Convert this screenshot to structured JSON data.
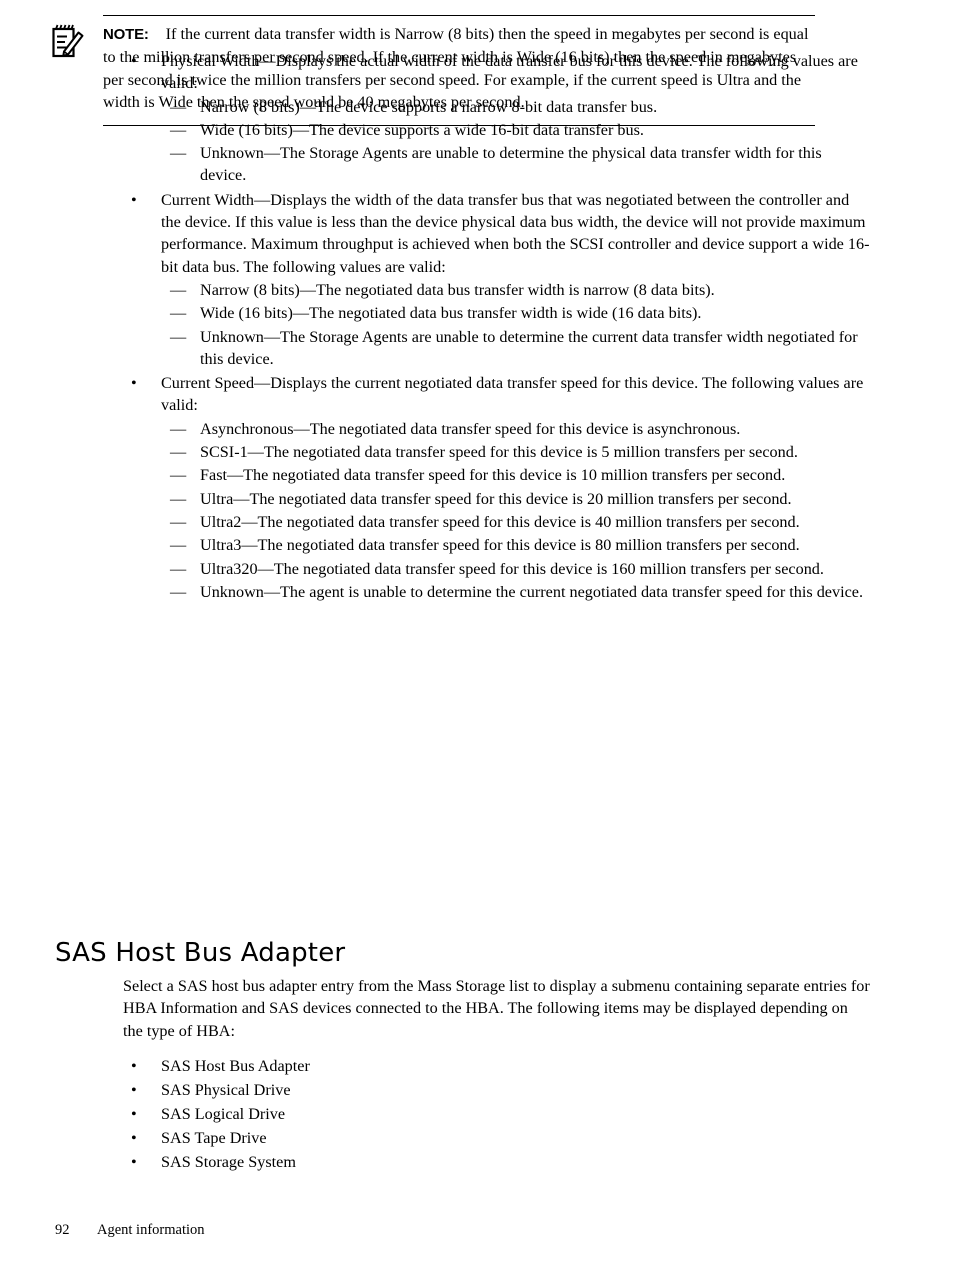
{
  "page": {
    "footer_page_number": "92",
    "footer_chapter": "Agent information"
  },
  "bullets": [
    {
      "lead": "Physical Width—Displays the actual width of the data transfer bus for this device. The following values are valid:",
      "sub": [
        "Narrow (8 bits)—The device supports a narrow 8-bit data transfer bus.",
        "Wide (16 bits)—The device supports a wide 16-bit data transfer bus.",
        "Unknown—The Storage Agents are unable to determine the physical data transfer width for this device."
      ]
    },
    {
      "lead": "Current Width—Displays the width of the data transfer bus that was negotiated between the controller and the device. If this value is less than the device physical data bus width, the device will not provide maximum performance. Maximum throughput is achieved when both the SCSI controller and device support a wide 16-bit data bus. The following values are valid:",
      "sub": [
        "Narrow (8 bits)—The negotiated data bus transfer width is narrow (8 data bits).",
        "Wide (16 bits)—The negotiated data bus transfer width is wide (16 data bits).",
        "Unknown—The Storage Agents are unable to determine the current data transfer width negotiated for this device."
      ]
    },
    {
      "lead": "Current Speed—Displays the current negotiated data transfer speed for this device. The following values are valid:",
      "sub": [
        "Asynchronous—The negotiated data transfer speed for this device is asynchronous.",
        "SCSI-1—The negotiated data transfer speed for this device is 5 million transfers per second.",
        "Fast—The negotiated data transfer speed for this device is 10 million transfers per second.",
        "Ultra—The negotiated data transfer speed for this device is 20 million transfers per second.",
        "Ultra2—The negotiated data transfer speed for this device is 40 million transfers per second.",
        "Ultra3—The negotiated data transfer speed for this device is 80 million transfers per second.",
        "Ultra320—The negotiated data transfer speed for this device is 160 million transfers per second.",
        "Unknown—The agent is unable to determine the current negotiated data transfer speed for this device."
      ]
    }
  ],
  "note": {
    "icon": "note-pad-pencil-icon",
    "label": "NOTE:",
    "text": "If the current data transfer width is Narrow (8 bits) then the speed in megabytes per second is equal to the million transfers per second speed. If the current width is Wide (16 bits) then the speed in megabytes per second is twice the million transfers per second speed. For example, if the current speed is Ultra and the width is Wide then the speed would be 40 megabytes per second."
  },
  "section": {
    "heading": "SAS Host Bus Adapter",
    "paragraph": "Select a SAS host bus adapter entry from the Mass Storage list to display a submenu containing separate entries for HBA Information and SAS devices connected to the HBA. The following items may be displayed depending on the type of HBA:",
    "items": [
      "SAS Host Bus Adapter",
      "SAS Physical Drive",
      "SAS Logical Drive",
      "SAS Tape Drive",
      "SAS Storage System"
    ]
  },
  "glyphs": {
    "bullet": "•",
    "dash": "—"
  }
}
